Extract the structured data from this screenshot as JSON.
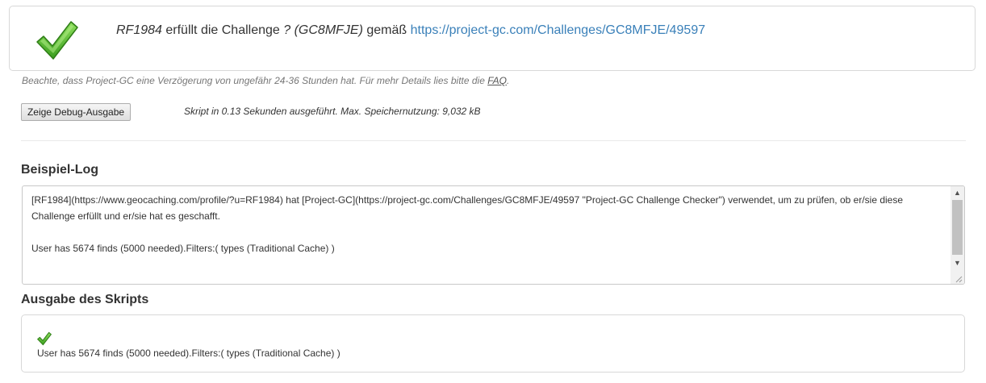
{
  "result": {
    "user": "RF1984",
    "text_fulfills": "erfüllt die Challenge",
    "challenge": "? (GC8MFJE)",
    "text_according": "gemäß",
    "link": "https://project-gc.com/Challenges/GC8MFJE/49597",
    "icon": "checkmark-icon",
    "icon_color": "#4caf2c"
  },
  "note": {
    "text": "Beachte, dass Project-GC eine Verzögerung von ungefähr 24-36 Stunden hat. Für mehr Details lies bitte die",
    "faq_link": "FAQ",
    "suffix": "."
  },
  "debug_button": "Zeige Debug-Ausgabe",
  "execution_info": "Skript in 0.13 Sekunden ausgeführt. Max. Speichernutzung: 9,032 kB",
  "sample_log": {
    "heading": "Beispiel-Log",
    "text": "[RF1984](https://www.geocaching.com/profile/?u=RF1984) hat [Project-GC](https://project-gc.com/Challenges/GC8MFJE/49597 \"Project-GC Challenge Checker\") verwendet, um zu prüfen, ob er/sie diese Challenge erfüllt und er/sie hat es geschafft.\n\nUser has 5674 finds (5000 needed).Filters:( types (Traditional Cache) )"
  },
  "script_output": {
    "heading": "Ausgabe des Skripts",
    "icon": "checkmark-icon",
    "text": "User has 5674 finds (5000 needed).Filters:( types (Traditional Cache) )"
  }
}
